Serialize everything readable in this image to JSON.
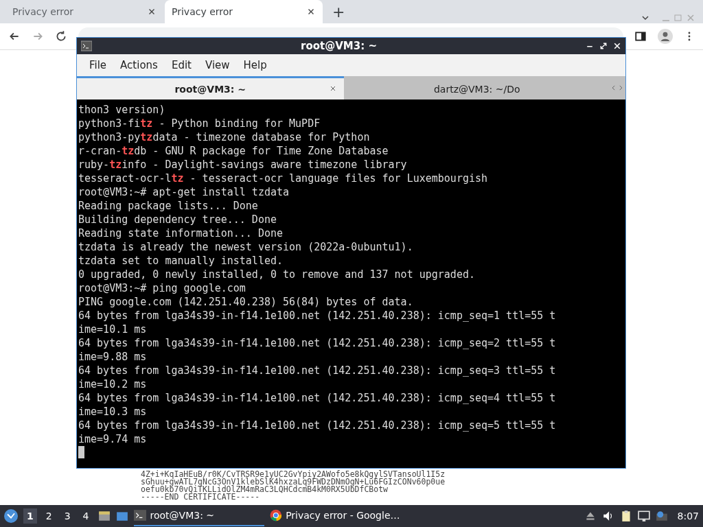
{
  "browser": {
    "tabs": [
      {
        "title": "Privacy error",
        "selected": false
      },
      {
        "title": "Privacy error",
        "selected": true
      }
    ],
    "new_tab": "+"
  },
  "page_text": [
    "4Z+i+KqIaHEuB/r0K/CvTRSR9e1yUC2GvYpiy2AWofo5e8kQgylSVTansoUl1I5z",
    "sGhuu+gwATL7gNcG3OnV1klebSlK4hxzaLq9FWDzDNmOgN+Lu6FGIzCONv60p0ue",
    "oefu0kb70vQiTKLLidOlZM4mRaC3LQHCdcmB4kM0RX5UbDfCBotw",
    "-----END CERTIFICATE-----"
  ],
  "terminal": {
    "title": "root@VM3: ~",
    "menu": [
      "File",
      "Actions",
      "Edit",
      "View",
      "Help"
    ],
    "tabs": [
      {
        "title": "root@VM3: ~",
        "selected": true
      },
      {
        "title": "dartz@VM3: ~/Do",
        "selected": false
      }
    ],
    "lines": [
      [
        {
          "kind": "plain",
          "text": "thon3 version)"
        }
      ],
      [
        {
          "kind": "plain",
          "text": "python3-fi"
        },
        {
          "kind": "match",
          "text": "tz"
        },
        {
          "kind": "plain",
          "text": " - Python binding for MuPDF"
        }
      ],
      [
        {
          "kind": "plain",
          "text": "python3-py"
        },
        {
          "kind": "match",
          "text": "tz"
        },
        {
          "kind": "plain",
          "text": "data - timezone database for Python"
        }
      ],
      [
        {
          "kind": "plain",
          "text": "r-cran-"
        },
        {
          "kind": "match",
          "text": "tz"
        },
        {
          "kind": "plain",
          "text": "db - GNU R package for Time Zone Database"
        }
      ],
      [
        {
          "kind": "plain",
          "text": "ruby-"
        },
        {
          "kind": "match",
          "text": "tz"
        },
        {
          "kind": "plain",
          "text": "info - Daylight-savings aware timezone library"
        }
      ],
      [
        {
          "kind": "plain",
          "text": "tesseract-ocr-l"
        },
        {
          "kind": "match",
          "text": "tz"
        },
        {
          "kind": "plain",
          "text": " - tesseract-ocr language files for Luxembourgish"
        }
      ],
      [
        {
          "kind": "plain",
          "text": "root@VM3:~# apt-get install tzdata"
        }
      ],
      [
        {
          "kind": "plain",
          "text": "Reading package lists... Done"
        }
      ],
      [
        {
          "kind": "plain",
          "text": "Building dependency tree... Done"
        }
      ],
      [
        {
          "kind": "plain",
          "text": "Reading state information... Done"
        }
      ],
      [
        {
          "kind": "plain",
          "text": "tzdata is already the newest version (2022a-0ubuntu1)."
        }
      ],
      [
        {
          "kind": "plain",
          "text": "tzdata set to manually installed."
        }
      ],
      [
        {
          "kind": "plain",
          "text": "0 upgraded, 0 newly installed, 0 to remove and 137 not upgraded."
        }
      ],
      [
        {
          "kind": "plain",
          "text": "root@VM3:~# ping google.com"
        }
      ],
      [
        {
          "kind": "plain",
          "text": "PING google.com (142.251.40.238) 56(84) bytes of data."
        }
      ],
      [
        {
          "kind": "plain",
          "text": "64 bytes from lga34s39-in-f14.1e100.net (142.251.40.238): icmp_seq=1 ttl=55 t"
        }
      ],
      [
        {
          "kind": "plain",
          "text": "ime=10.1 ms"
        }
      ],
      [
        {
          "kind": "plain",
          "text": "64 bytes from lga34s39-in-f14.1e100.net (142.251.40.238): icmp_seq=2 ttl=55 t"
        }
      ],
      [
        {
          "kind": "plain",
          "text": "ime=9.88 ms"
        }
      ],
      [
        {
          "kind": "plain",
          "text": "64 bytes from lga34s39-in-f14.1e100.net (142.251.40.238): icmp_seq=3 ttl=55 t"
        }
      ],
      [
        {
          "kind": "plain",
          "text": "ime=10.2 ms"
        }
      ],
      [
        {
          "kind": "plain",
          "text": "64 bytes from lga34s39-in-f14.1e100.net (142.251.40.238): icmp_seq=4 ttl=55 t"
        }
      ],
      [
        {
          "kind": "plain",
          "text": "ime=10.3 ms"
        }
      ],
      [
        {
          "kind": "plain",
          "text": "64 bytes from lga34s39-in-f14.1e100.net (142.251.40.238): icmp_seq=5 ttl=55 t"
        }
      ],
      [
        {
          "kind": "plain",
          "text": "ime=9.74 ms"
        }
      ]
    ]
  },
  "taskbar": {
    "workspaces": [
      {
        "label": "1",
        "selected": true
      },
      {
        "label": "2",
        "selected": false
      },
      {
        "label": "3",
        "selected": false
      },
      {
        "label": "4",
        "selected": false
      }
    ],
    "tasks": [
      {
        "title": "root@VM3: ~",
        "kind": "terminal",
        "selected": true
      },
      {
        "title": "Privacy error - Google…",
        "kind": "browser",
        "selected": false
      }
    ],
    "clock": "8:07"
  }
}
